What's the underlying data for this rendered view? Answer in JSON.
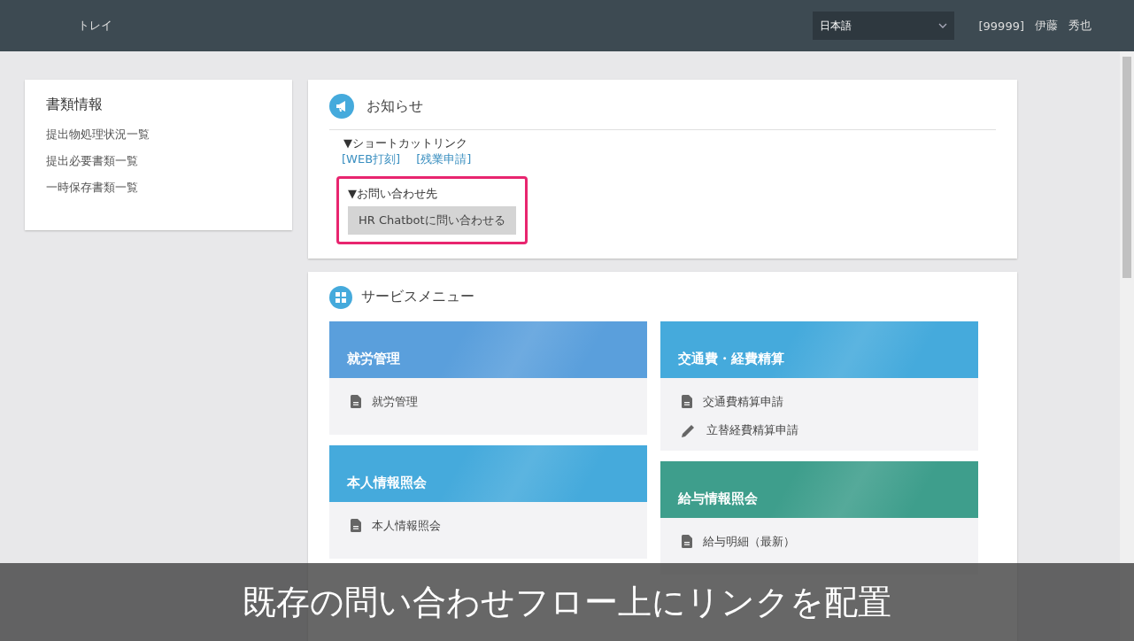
{
  "header": {
    "title": "トレイ",
    "language": "日本語",
    "user_id": "[99999]",
    "user_name": [
      "伊藤",
      "秀也"
    ]
  },
  "sidebar": {
    "title": "書類情報",
    "items": [
      "提出物処理状況一覧",
      "提出必要書類一覧",
      "一時保存書類一覧"
    ]
  },
  "notice": {
    "title": "お知らせ",
    "shortcut_heading": "▼ショートカットリンク",
    "shortcut_links": [
      "[WEB打刻]",
      "[残業申請]"
    ],
    "contact_heading": "▼お問い合わせ先",
    "contact_button": "HR Chatbotに問い合わせる",
    "highlighted": true
  },
  "service_menu": {
    "title": "サービスメニュー",
    "columns": [
      [
        {
          "title": "就労管理",
          "color": "#5a9fdc",
          "items": [
            {
              "label": "就労管理",
              "kind": "document"
            }
          ]
        },
        {
          "title": "本人情報照会",
          "color": "#45aadc",
          "items": [
            {
              "label": "本人情報照会",
              "kind": "document"
            }
          ]
        }
      ],
      [
        {
          "title": "交通費・経費精算",
          "color": "#45aadc",
          "items": [
            {
              "label": "交通費精算申請",
              "kind": "document"
            },
            {
              "label": "立替経費精算申請",
              "kind": "pencil"
            }
          ]
        },
        {
          "title": "給与情報照会",
          "color": "#3e9e8c",
          "items": [
            {
              "label": "給与明細（最新）",
              "kind": "document"
            }
          ]
        }
      ]
    ]
  },
  "caption": "既存の問い合わせフロー上にリンクを配置"
}
